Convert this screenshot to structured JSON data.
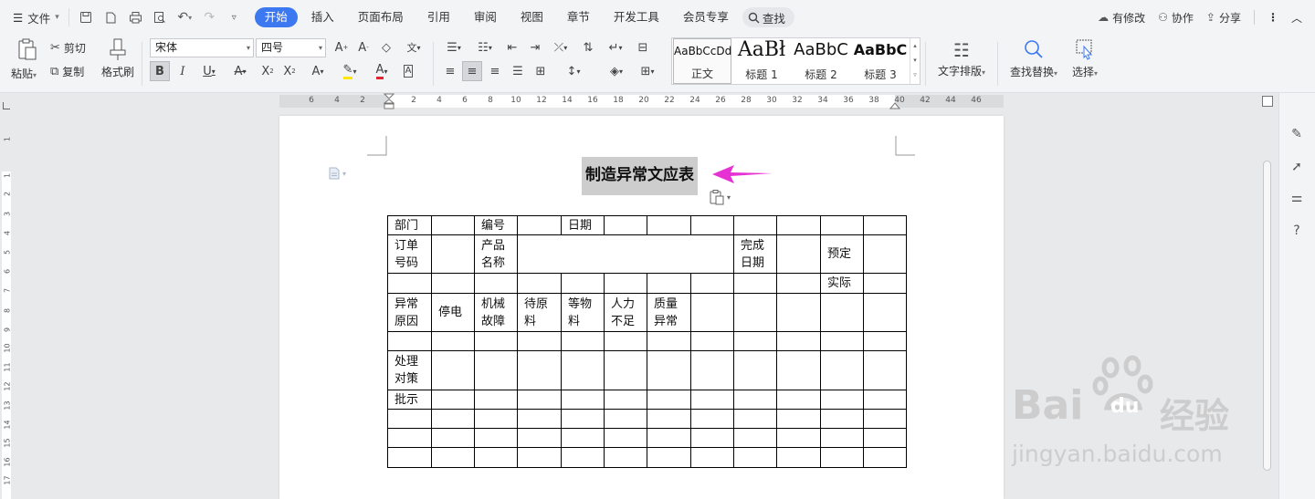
{
  "menubar": {
    "file_label": "文件",
    "tabs": [
      "开始",
      "插入",
      "页面布局",
      "引用",
      "审阅",
      "视图",
      "章节",
      "开发工具",
      "会员专享"
    ],
    "search_label": "查找",
    "changes_label": "有修改",
    "collab_label": "协作",
    "share_label": "分享"
  },
  "ribbon": {
    "paste_label": "粘贴",
    "cut_label": "剪切",
    "copy_label": "复制",
    "format_painter_label": "格式刷",
    "font_name": "宋体",
    "font_size": "四号",
    "styles": [
      {
        "sample": "AaBbCcDd",
        "name": "正文"
      },
      {
        "sample": "AaBł",
        "name": "标题 1"
      },
      {
        "sample": "AaBbC",
        "name": "标题 2"
      },
      {
        "sample": "AaBbC",
        "name": "标题 3"
      }
    ],
    "text_layout_label": "文字排版",
    "find_replace_label": "查找替换",
    "select_label": "选择"
  },
  "ruler": {
    "numbers": [
      "6",
      "4",
      "2",
      "2",
      "4",
      "6",
      "8",
      "10",
      "12",
      "14",
      "16",
      "18",
      "20",
      "22",
      "24",
      "26",
      "28",
      "30",
      "32",
      "34",
      "36",
      "38",
      "40",
      "42",
      "44",
      "46"
    ]
  },
  "vruler": {
    "numbers": [
      "1",
      "1",
      "2",
      "3",
      "4",
      "5",
      "6",
      "7",
      "8",
      "9",
      "10",
      "11",
      "12",
      "13",
      "14",
      "15",
      "16",
      "17"
    ]
  },
  "document": {
    "title": "制造异常文应表",
    "table": {
      "r1": [
        "部门",
        "",
        "编号",
        "",
        "日期"
      ],
      "r2": {
        "order": "订单\n号码",
        "product": "产品\n名称",
        "done": "完成\n日期",
        "planned": "预定"
      },
      "r3": {
        "actual": "实际"
      },
      "r4": [
        "异常\n原因",
        "停电",
        "机械\n故障",
        "待原\n料",
        "等物\n料",
        "人力\n不足",
        "质量\n异常"
      ],
      "r6": "处理\n对策",
      "r7": "批示"
    }
  },
  "watermark": {
    "brand": "Bai",
    "brand2": "du",
    "cn": "经验",
    "url": "jingyan.baidu.com"
  },
  "colors": {
    "accent": "#3c78f0",
    "arrow": "#e632d2",
    "selection": "#cdcdcd"
  }
}
